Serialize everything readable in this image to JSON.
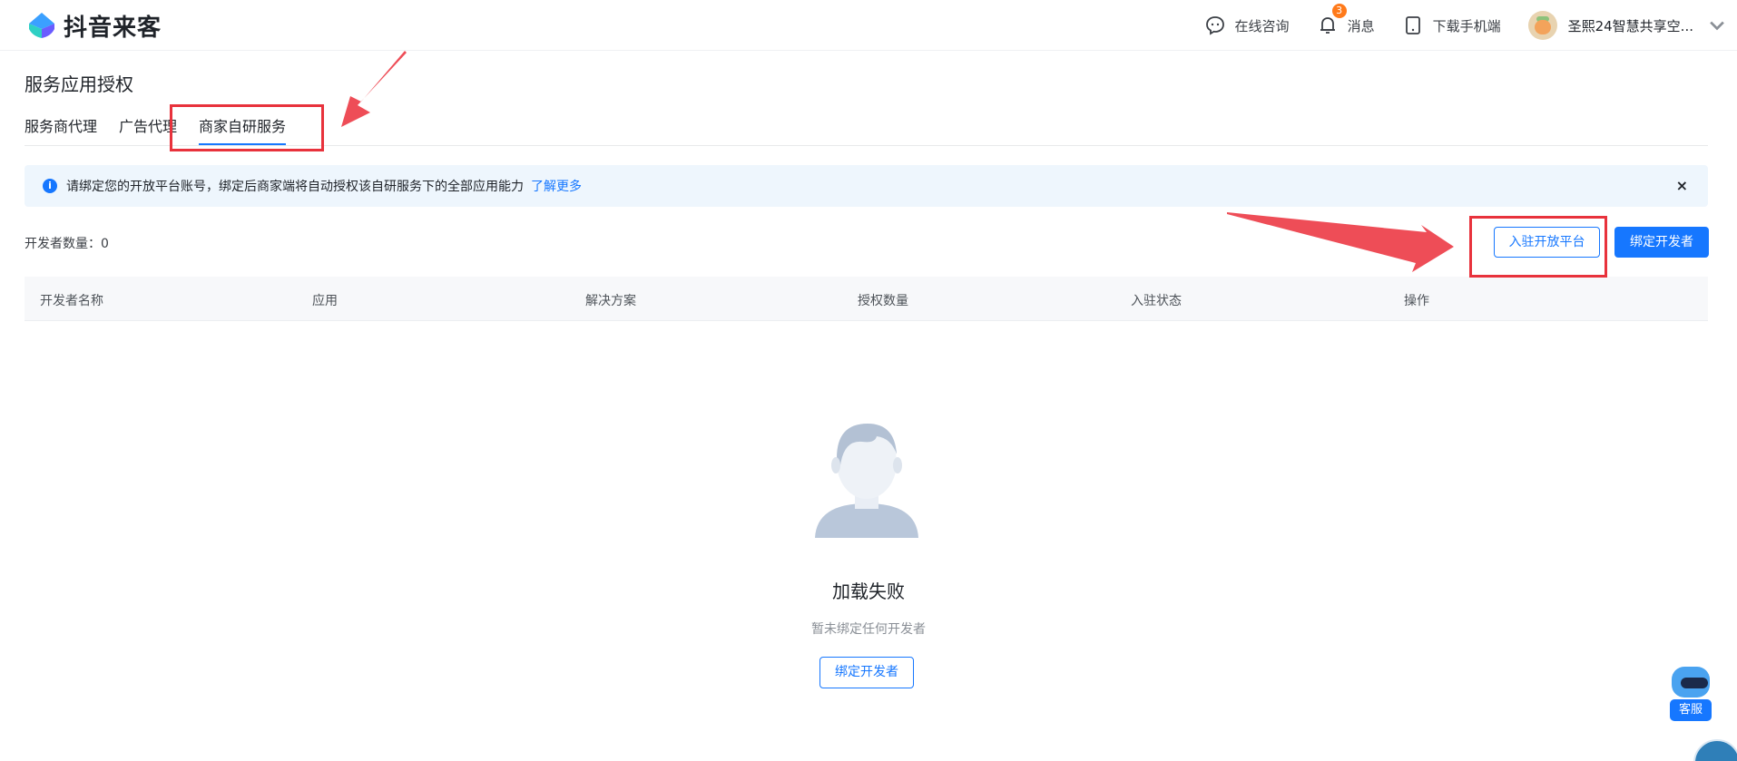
{
  "header": {
    "brand": "抖音来客",
    "online_consult": "在线咨询",
    "messages": "消息",
    "message_badge": "3",
    "download_mobile": "下载手机端",
    "user_name": "圣熙24智慧共享空..."
  },
  "page": {
    "title": "服务应用授权",
    "tabs": [
      {
        "label": "服务商代理"
      },
      {
        "label": "广告代理"
      },
      {
        "label": "商家自研服务",
        "active": true
      }
    ]
  },
  "notice": {
    "message": "请绑定您的开放平台账号，绑定后商家端将自动授权该自研服务下的全部应用能力",
    "link": "了解更多",
    "close": "×"
  },
  "toolbar": {
    "developer_count": "开发者数量：0",
    "join_platform": "入驻开放平台",
    "bind_developer": "绑定开发者"
  },
  "table": {
    "columns": [
      "开发者名称",
      "应用",
      "解决方案",
      "授权数量",
      "入驻状态",
      "操作"
    ]
  },
  "empty_state": {
    "title": "加载失败",
    "subtitle": "暂未绑定任何开发者",
    "button": "绑定开发者"
  },
  "customer_service": {
    "label": "客服"
  },
  "colors": {
    "primary": "#1677ff",
    "annotation_red": "#e8323c",
    "notice_bg": "#eef6fd"
  }
}
